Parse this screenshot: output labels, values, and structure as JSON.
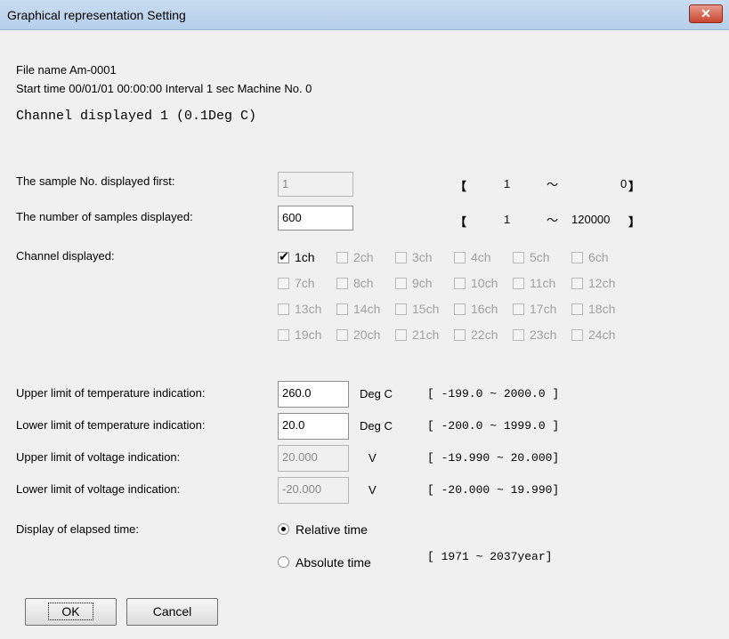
{
  "window": {
    "title": "Graphical representation Setting",
    "close_glyph": "✕"
  },
  "info": {
    "file_name": "File name Am-0001",
    "start_line": "Start time 00/01/01 00:00:00  Interval 1 sec   Machine No. 0",
    "channel_line": "Channel displayed   1  (0.1Deg C)"
  },
  "sample_first": {
    "label": "The sample No. displayed first:",
    "value": "1",
    "range_open": "【",
    "range_min": "1",
    "range_sep": "〜",
    "range_max": "0",
    "range_close": "】"
  },
  "sample_count": {
    "label": "The number of samples displayed:",
    "value": "600",
    "range_open": "【",
    "range_min": "1",
    "range_sep": "〜",
    "range_max": "120000",
    "range_close": "】"
  },
  "channels": {
    "label": "Channel displayed:",
    "check_glyph": "✔",
    "items": [
      "1ch",
      "2ch",
      "3ch",
      "4ch",
      "5ch",
      "6ch",
      "7ch",
      "8ch",
      "9ch",
      "10ch",
      "11ch",
      "12ch",
      "13ch",
      "14ch",
      "15ch",
      "16ch",
      "17ch",
      "18ch",
      "19ch",
      "20ch",
      "21ch",
      "22ch",
      "23ch",
      "24ch"
    ],
    "checked": [
      "1ch"
    ]
  },
  "temp_upper": {
    "label": "Upper limit of temperature indication:",
    "value": "260.0",
    "unit": "Deg C",
    "range": "[  -199.0    ~     2000.0  ]"
  },
  "temp_lower": {
    "label": "Lower limit of temperature indication:",
    "value": "20.0",
    "unit": "Deg C",
    "range": "[  -200.0    ~     1999.0  ]"
  },
  "volt_upper": {
    "label": "Upper limit of voltage indication:",
    "value": "20.000",
    "unit": "V",
    "range": "[     -19.990 ~        20.000]"
  },
  "volt_lower": {
    "label": "Lower limit of voltage indication:",
    "value": "-20.000",
    "unit": "V",
    "range": "[     -20.000 ~        19.990]"
  },
  "elapsed": {
    "label": "Display of elapsed time:",
    "options": [
      "Relative time",
      "Absolute time"
    ],
    "selected": "Relative time",
    "range": "[     1971     ~     2037year]"
  },
  "buttons": {
    "ok": "OK",
    "cancel": "Cancel"
  }
}
